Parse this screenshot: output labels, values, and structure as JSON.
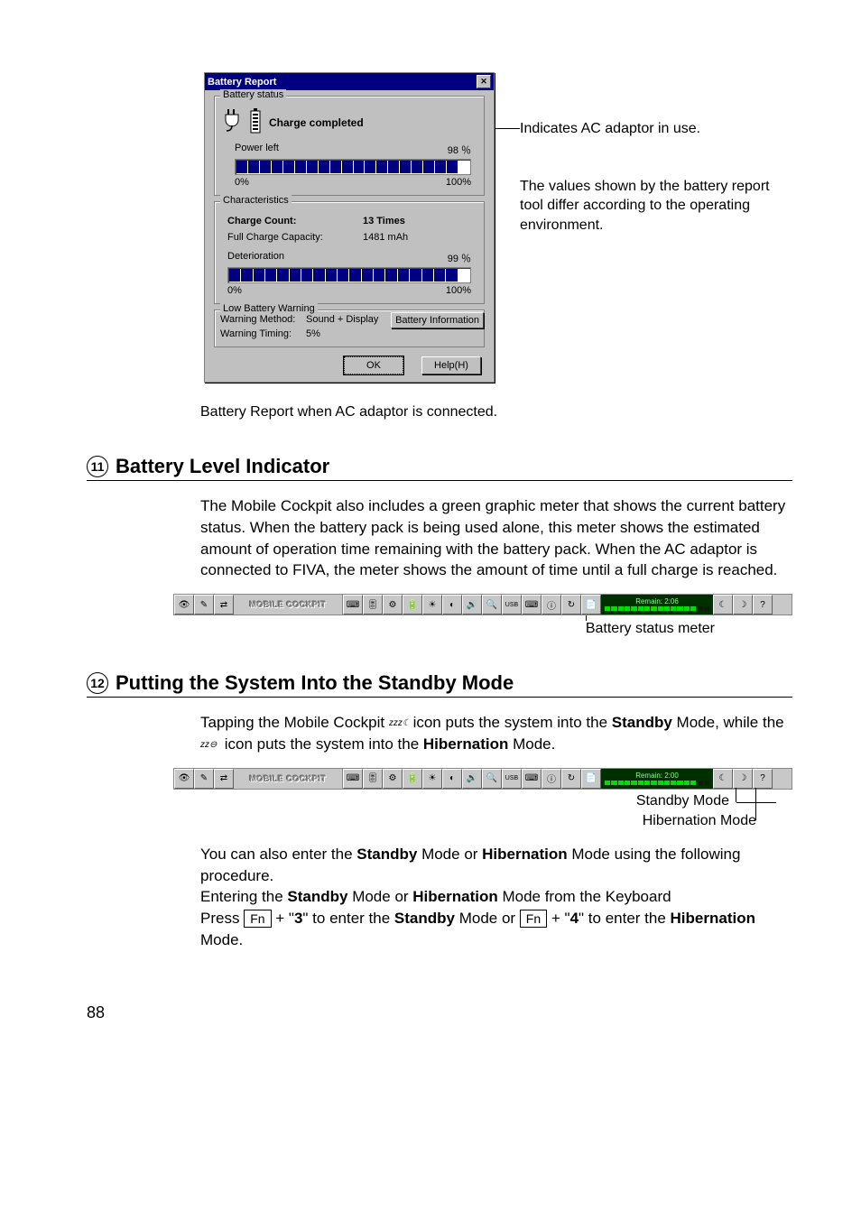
{
  "dialog": {
    "title": "Battery Report",
    "close_glyph": "✕",
    "group_status": {
      "label": "Battery status",
      "status_text": "Charge completed",
      "power_left_label": "Power left",
      "power_left_value": "98 ％",
      "range_min": "0%",
      "range_max": "100%"
    },
    "group_char": {
      "label": "Characteristics",
      "charge_count_label": "Charge Count:",
      "charge_count_value": "13 Times",
      "full_cap_label": "Full Charge Capacity:",
      "full_cap_value": "1481 mAh",
      "deterioration_label": "Deterioration",
      "deterioration_value": "99 ％",
      "range_min": "0%",
      "range_max": "100%"
    },
    "group_low": {
      "label": "Low Battery Warning",
      "method_label": "Warning Method:",
      "method_value": "Sound + Display",
      "timing_label": "Warning Timing:",
      "timing_value": "5%",
      "binfo_btn": "Battery Information"
    },
    "ok_btn": "OK",
    "help_btn": "Help(H)"
  },
  "callouts": {
    "ac_note": "Indicates AC adaptor in use.",
    "values_note": "The values shown by the battery report tool differ according to the operating environment."
  },
  "caption": "Battery Report when AC adaptor is connected.",
  "section11": {
    "num": "11",
    "title": "Battery Level Indicator",
    "body": "The Mobile Cockpit also includes a green graphic meter that shows the current battery status. When the battery pack is being used alone, this meter shows the estimated amount of operation time remaining with the battery pack. When the AC adaptor is connected to FIVA, the meter shows the amount of time until a full charge is reached.",
    "meter_label": "Remain: 2:06",
    "meter_callout": "Battery status meter"
  },
  "toolbar": {
    "logo": "MOBILE COCKPIT",
    "icons": [
      "eye-icon",
      "pen-icon",
      "swap-icon",
      "keyboard-icon",
      "slider-icon",
      "gear-icon",
      "battery-icon",
      "brightness-icon",
      "contrast-icon",
      "volume-icon",
      "zoom-icon",
      "usb-icon",
      "keypad-icon",
      "info-icon",
      "rotate-icon",
      "doc-icon"
    ],
    "glyphs": [
      "👁",
      "✎",
      "⇄",
      "⌨",
      "🎚",
      "⚙",
      "🔋",
      "☀",
      "◐",
      "🔊",
      "🔍",
      "USB",
      "⌨",
      "ⓘ",
      "↻",
      "📄"
    ],
    "right_icons": [
      "standby-icon",
      "hibernate-icon",
      "help-icon"
    ],
    "right_glyphs": [
      "☾",
      "☽",
      "?"
    ]
  },
  "section12": {
    "num": "12",
    "title": "Putting the System Into the Standby Mode",
    "p1a": "Tapping the Mobile Cockpit ",
    "p1b": " icon puts the system into the ",
    "p1_mode1": "Standby",
    "p1c": " Mode, while the ",
    "p1d": " icon puts the system into the ",
    "p1_mode2": "Hibernation",
    "p1e": " Mode.",
    "standby_icon_txt": "zzz☾",
    "hib_icon_txt": "zz⊖",
    "meter_label": "Remain: 2:00",
    "standby_callout": "Standby Mode",
    "hib_callout": "Hibernation Mode",
    "p2a": "You can also enter the ",
    "p2b": " Mode or ",
    "p2c": " Mode using the following procedure.",
    "p3a": "Entering the ",
    "p3b": " Mode or ",
    "p3c": " Mode from the Keyboard",
    "p4a": "Press ",
    "fn": "Fn",
    "p4b": " + \"",
    "k3": "3",
    "p4c": "\" to enter the ",
    "p4d": " Mode or ",
    "k4": "4",
    "p4e": "\" to enter the ",
    "p4f": " Mode."
  },
  "page_number": "88"
}
